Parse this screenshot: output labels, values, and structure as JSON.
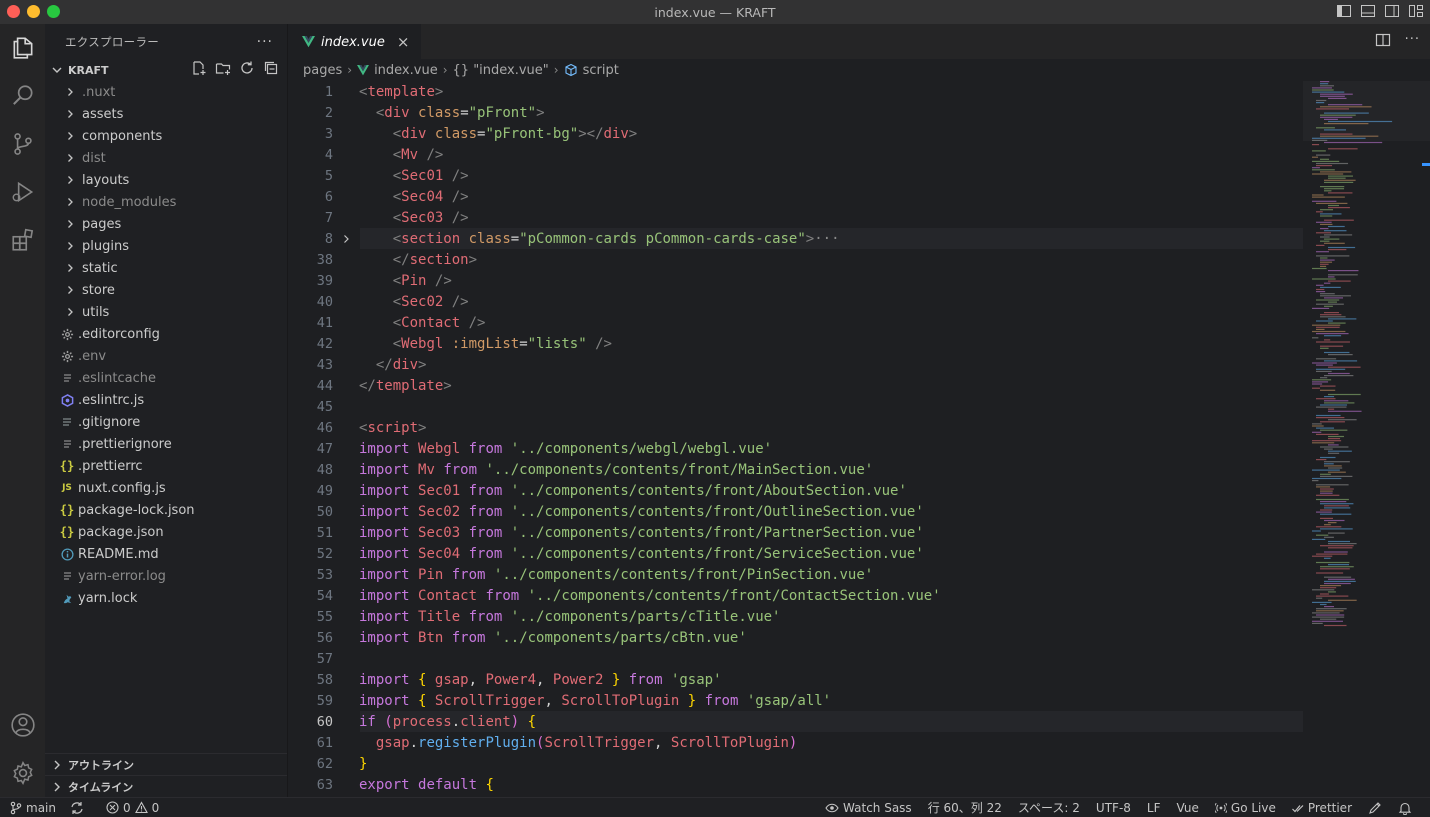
{
  "window": {
    "title": "index.vue — KRAFT",
    "traffic_colors": [
      "#fe5f57",
      "#febc2e",
      "#28c840"
    ]
  },
  "activity": {
    "items": [
      "explorer-icon",
      "search-icon",
      "source-control-icon",
      "run-debug-icon",
      "extensions-icon",
      "account-icon",
      "settings-gear-icon"
    ]
  },
  "sidebar": {
    "title": "エクスプローラー",
    "more": "···",
    "section_name": "KRAFT",
    "tree": [
      {
        "name": ".nuxt",
        "kind": "folder",
        "color": "#8b8b8b"
      },
      {
        "name": "assets",
        "kind": "folder",
        "color": "#cccccc"
      },
      {
        "name": "components",
        "kind": "folder",
        "color": "#cccccc"
      },
      {
        "name": "dist",
        "kind": "folder",
        "color": "#8b8b8b"
      },
      {
        "name": "layouts",
        "kind": "folder",
        "color": "#cccccc"
      },
      {
        "name": "node_modules",
        "kind": "folder",
        "color": "#8b8b8b"
      },
      {
        "name": "pages",
        "kind": "folder",
        "color": "#cccccc"
      },
      {
        "name": "plugins",
        "kind": "folder",
        "color": "#cccccc"
      },
      {
        "name": "static",
        "kind": "folder",
        "color": "#cccccc"
      },
      {
        "name": "store",
        "kind": "folder",
        "color": "#cccccc"
      },
      {
        "name": "utils",
        "kind": "folder",
        "color": "#cccccc"
      },
      {
        "name": ".editorconfig",
        "kind": "file",
        "icon": "gear",
        "color": "#cccccc"
      },
      {
        "name": ".env",
        "kind": "file",
        "icon": "gear",
        "color": "#8b8b8b"
      },
      {
        "name": ".eslintcache",
        "kind": "file",
        "icon": "lines",
        "color": "#8b8b8b"
      },
      {
        "name": ".eslintrc.js",
        "kind": "file",
        "icon": "eslint",
        "color": "#cccccc"
      },
      {
        "name": ".gitignore",
        "kind": "file",
        "icon": "git",
        "color": "#cccccc"
      },
      {
        "name": ".prettierignore",
        "kind": "file",
        "icon": "lines",
        "color": "#cccccc"
      },
      {
        "name": ".prettierrc",
        "kind": "file",
        "icon": "json",
        "color": "#cccccc"
      },
      {
        "name": "nuxt.config.js",
        "kind": "file",
        "icon": "js",
        "color": "#cccccc"
      },
      {
        "name": "package-lock.json",
        "kind": "file",
        "icon": "json",
        "color": "#cccccc"
      },
      {
        "name": "package.json",
        "kind": "file",
        "icon": "json",
        "color": "#cccccc"
      },
      {
        "name": "README.md",
        "kind": "file",
        "icon": "info",
        "color": "#cccccc"
      },
      {
        "name": "yarn-error.log",
        "kind": "file",
        "icon": "lines",
        "color": "#8b8b8b"
      },
      {
        "name": "yarn.lock",
        "kind": "file",
        "icon": "yarn",
        "color": "#cccccc"
      }
    ],
    "outline": "アウトライン",
    "timeline": "タイムライン"
  },
  "editor": {
    "tab": {
      "label": "index.vue",
      "close": "×"
    },
    "breadcrumb": [
      "pages",
      "index.vue",
      "{} \"index.vue\"",
      "script"
    ],
    "active_line": 60,
    "lines": [
      {
        "n": "1",
        "t": "<template>"
      },
      {
        "n": "2",
        "t": "  <div class=\"pFront\">"
      },
      {
        "n": "3",
        "t": "    <div class=\"pFront-bg\"></div>"
      },
      {
        "n": "4",
        "t": "    <Mv />"
      },
      {
        "n": "5",
        "t": "    <Sec01 />"
      },
      {
        "n": "6",
        "t": "    <Sec04 />"
      },
      {
        "n": "7",
        "t": "    <Sec03 />"
      },
      {
        "n": "8",
        "t": "    <section class=\"pCommon-cards pCommon-cards-case\">···",
        "fold": true
      },
      {
        "n": "38",
        "t": "    </section>"
      },
      {
        "n": "39",
        "t": "    <Pin />"
      },
      {
        "n": "40",
        "t": "    <Sec02 />"
      },
      {
        "n": "41",
        "t": "    <Contact />"
      },
      {
        "n": "42",
        "t": "    <Webgl :imgList=\"lists\" />"
      },
      {
        "n": "43",
        "t": "  </div>"
      },
      {
        "n": "44",
        "t": "</template>"
      },
      {
        "n": "45",
        "t": ""
      },
      {
        "n": "46",
        "t": "<script>"
      },
      {
        "n": "47",
        "t": "import Webgl from '../components/webgl/webgl.vue'"
      },
      {
        "n": "48",
        "t": "import Mv from '../components/contents/front/MainSection.vue'"
      },
      {
        "n": "49",
        "t": "import Sec01 from '../components/contents/front/AboutSection.vue'"
      },
      {
        "n": "50",
        "t": "import Sec02 from '../components/contents/front/OutlineSection.vue'"
      },
      {
        "n": "51",
        "t": "import Sec03 from '../components/contents/front/PartnerSection.vue'"
      },
      {
        "n": "52",
        "t": "import Sec04 from '../components/contents/front/ServiceSection.vue'"
      },
      {
        "n": "53",
        "t": "import Pin from '../components/contents/front/PinSection.vue'"
      },
      {
        "n": "54",
        "t": "import Contact from '../components/contents/front/ContactSection.vue'"
      },
      {
        "n": "55",
        "t": "import Title from '../components/parts/cTitle.vue'"
      },
      {
        "n": "56",
        "t": "import Btn from '../components/parts/cBtn.vue'"
      },
      {
        "n": "57",
        "t": ""
      },
      {
        "n": "58",
        "t": "import { gsap, Power4, Power2 } from 'gsap'"
      },
      {
        "n": "59",
        "t": "import { ScrollTrigger, ScrollToPlugin } from 'gsap/all'"
      },
      {
        "n": "60",
        "t": "if (process.client) {"
      },
      {
        "n": "61",
        "t": "  gsap.registerPlugin(ScrollTrigger, ScrollToPlugin)"
      },
      {
        "n": "62",
        "t": "}"
      },
      {
        "n": "63",
        "t": "export default {"
      }
    ]
  },
  "statusbar": {
    "branch": "main",
    "errors": "0",
    "warnings": "0",
    "watch_sass": "Watch Sass",
    "position": "行 60、列 22",
    "spaces": "スペース: 2",
    "encoding": "UTF-8",
    "eol": "LF",
    "language": "Vue",
    "golive": "Go Live",
    "prettier": "Prettier"
  },
  "colors": {
    "tag": "#e06c75",
    "attr": "#d19a66",
    "string": "#98c379",
    "keyword": "#c678dd",
    "ident": "#e06c75",
    "bracket": "#ffd700",
    "func": "#61afef",
    "punct": "#d4d4d4",
    "vue": "#41b883"
  }
}
